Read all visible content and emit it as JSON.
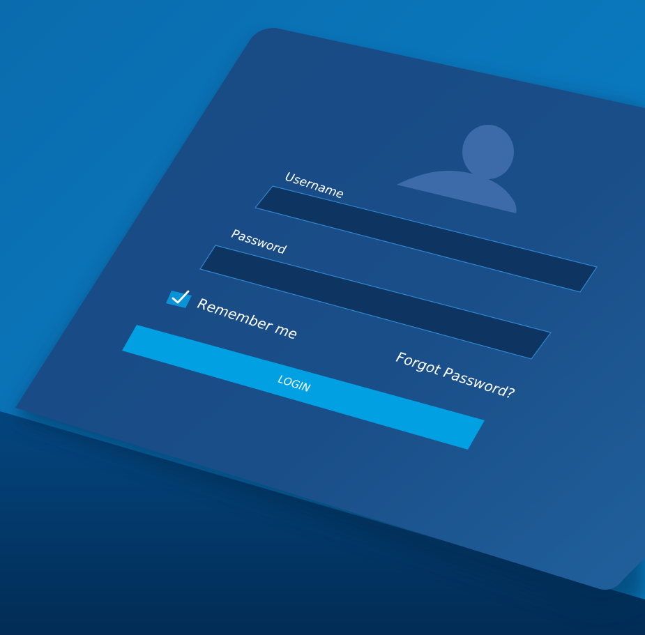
{
  "form": {
    "username_label": "Username",
    "username_value": "",
    "password_label": "Password",
    "password_value": "",
    "remember_label": "Remember me",
    "remember_checked": true,
    "forgot_label": "Forgot Password?",
    "login_label": "LOGIN"
  },
  "icons": {
    "avatar": "user-avatar-icon",
    "checkmark": "checkmark-icon"
  },
  "colors": {
    "background_light": "#0b82c4",
    "background_dark": "#043563",
    "panel": "#1a4c85",
    "input_fill": "#0e3462",
    "input_border": "#2f86cc",
    "avatar": "#3d6aa9",
    "accent": "#00a0e3"
  }
}
